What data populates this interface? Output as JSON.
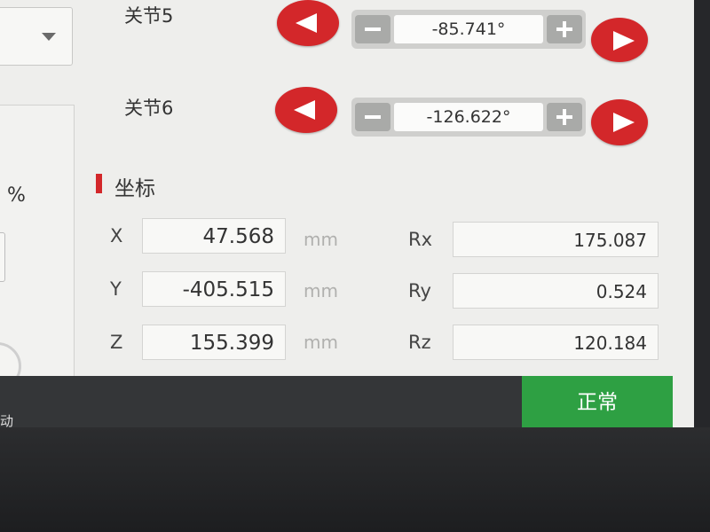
{
  "left": {
    "percent_symbol": "%",
    "cut_text": "动"
  },
  "joints": [
    {
      "label": "关节5",
      "value": "-85.741°"
    },
    {
      "label": "关节6",
      "value": "-126.622°"
    }
  ],
  "coordinates": {
    "title": "坐标",
    "accent_color": "#d3272a",
    "rows": [
      {
        "axis": "X",
        "value": "47.568",
        "unit": "mm",
        "rot_label": "Rx",
        "rot_value": "175.087"
      },
      {
        "axis": "Y",
        "value": "-405.515",
        "unit": "mm",
        "rot_label": "Ry",
        "rot_value": "0.524"
      },
      {
        "axis": "Z",
        "value": "155.399",
        "unit": "mm",
        "rot_label": "Rz",
        "rot_value": "120.184"
      }
    ]
  },
  "status": {
    "text": "正常",
    "color": "#2ea043"
  },
  "icons": {
    "decrease": "left-arrow-icon",
    "increase": "right-arrow-icon",
    "minus": "minus-icon",
    "plus": "plus-icon",
    "dropdown": "chevron-down-icon"
  }
}
